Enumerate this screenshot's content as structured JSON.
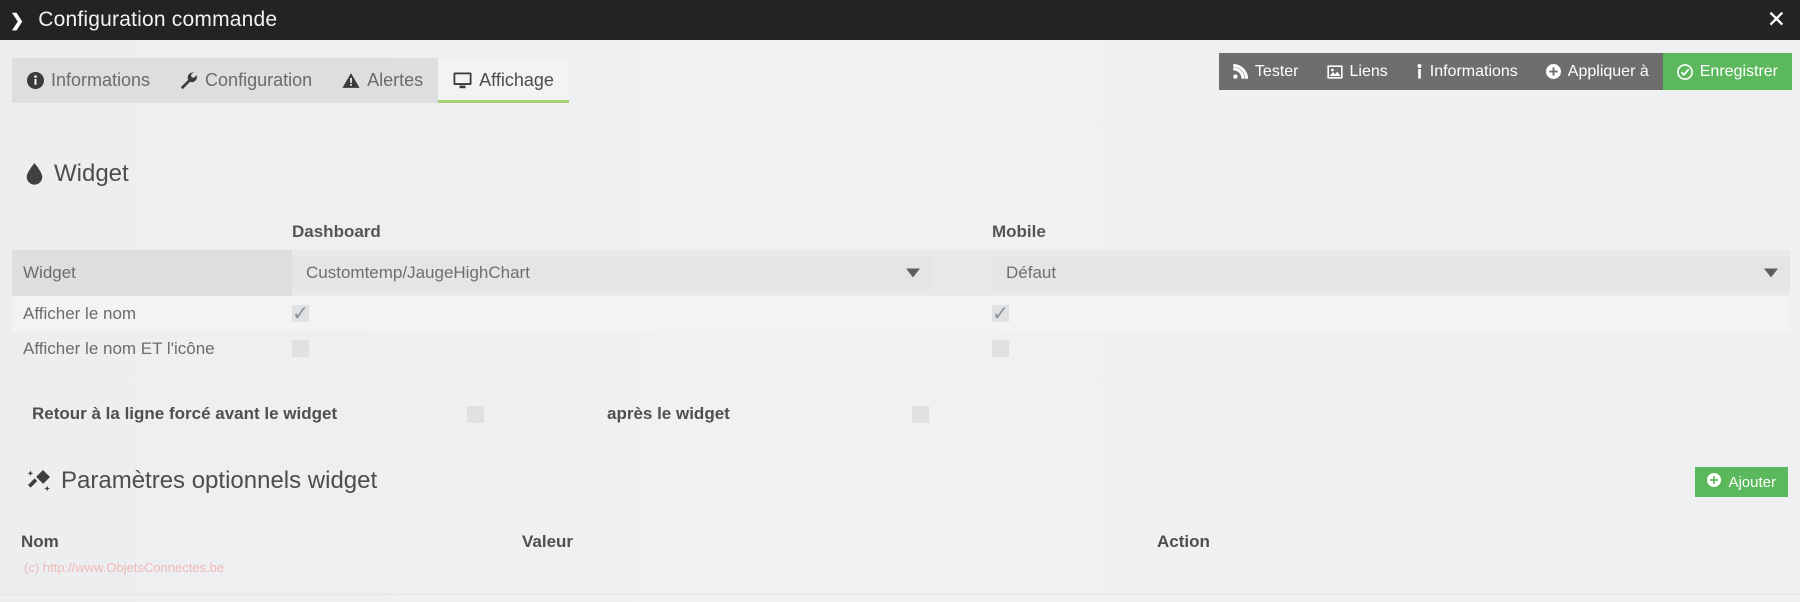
{
  "window": {
    "title": "Configuration commande",
    "chevron_icon": "chevron-right-icon",
    "close_icon": "close-icon"
  },
  "tabs": [
    {
      "label": "Informations",
      "icon": "info-circle-icon",
      "active": false
    },
    {
      "label": "Configuration",
      "icon": "wrench-icon",
      "active": false
    },
    {
      "label": "Alertes",
      "icon": "warning-triangle-icon",
      "active": false
    },
    {
      "label": "Affichage",
      "icon": "desktop-icon",
      "active": true
    }
  ],
  "actions": [
    {
      "label": "Tester",
      "icon": "rss-icon",
      "style": "grey"
    },
    {
      "label": "Liens",
      "icon": "image-icon",
      "style": "grey"
    },
    {
      "label": "Informations",
      "icon": "info-icon",
      "style": "grey"
    },
    {
      "label": "Appliquer à",
      "icon": "plus-circle-icon",
      "style": "grey"
    },
    {
      "label": "Enregistrer",
      "icon": "check-circle-icon",
      "style": "green"
    }
  ],
  "widget_section": {
    "title": "Widget",
    "icon": "tint-droplet-icon",
    "columns": {
      "dashboard": "Dashboard",
      "mobile": "Mobile"
    },
    "rows": [
      {
        "label": "Widget",
        "type": "select",
        "dashboard_value": "Customtemp/JaugeHighChart",
        "mobile_value": "Défaut"
      },
      {
        "label": "Afficher le nom",
        "type": "checkbox",
        "dashboard_checked": true,
        "mobile_checked": true
      },
      {
        "label": "Afficher le nom ET l'icône",
        "type": "checkbox",
        "dashboard_checked": false,
        "mobile_checked": false
      }
    ],
    "linebreak": {
      "label_before": "Retour à la ligne forcé avant le widget",
      "checked_before": false,
      "label_after": "après le widget",
      "checked_after": false
    }
  },
  "params_section": {
    "title": "Paramètres optionnels widget",
    "icon": "magic-wand-icon",
    "add_button": {
      "label": "Ajouter",
      "icon": "plus-circle-icon"
    },
    "columns": [
      "Nom",
      "Valeur",
      "Action"
    ],
    "rows": []
  },
  "footer": {
    "copyright": "(c) http://www.ObjetsConnectes.be"
  },
  "colors": {
    "titlebar": "#232323",
    "accent_green": "#5cb85c",
    "tab_active_underline": "#a8d173",
    "action_grey": "#6e6e6e",
    "copyright": "#f0b8ba"
  }
}
